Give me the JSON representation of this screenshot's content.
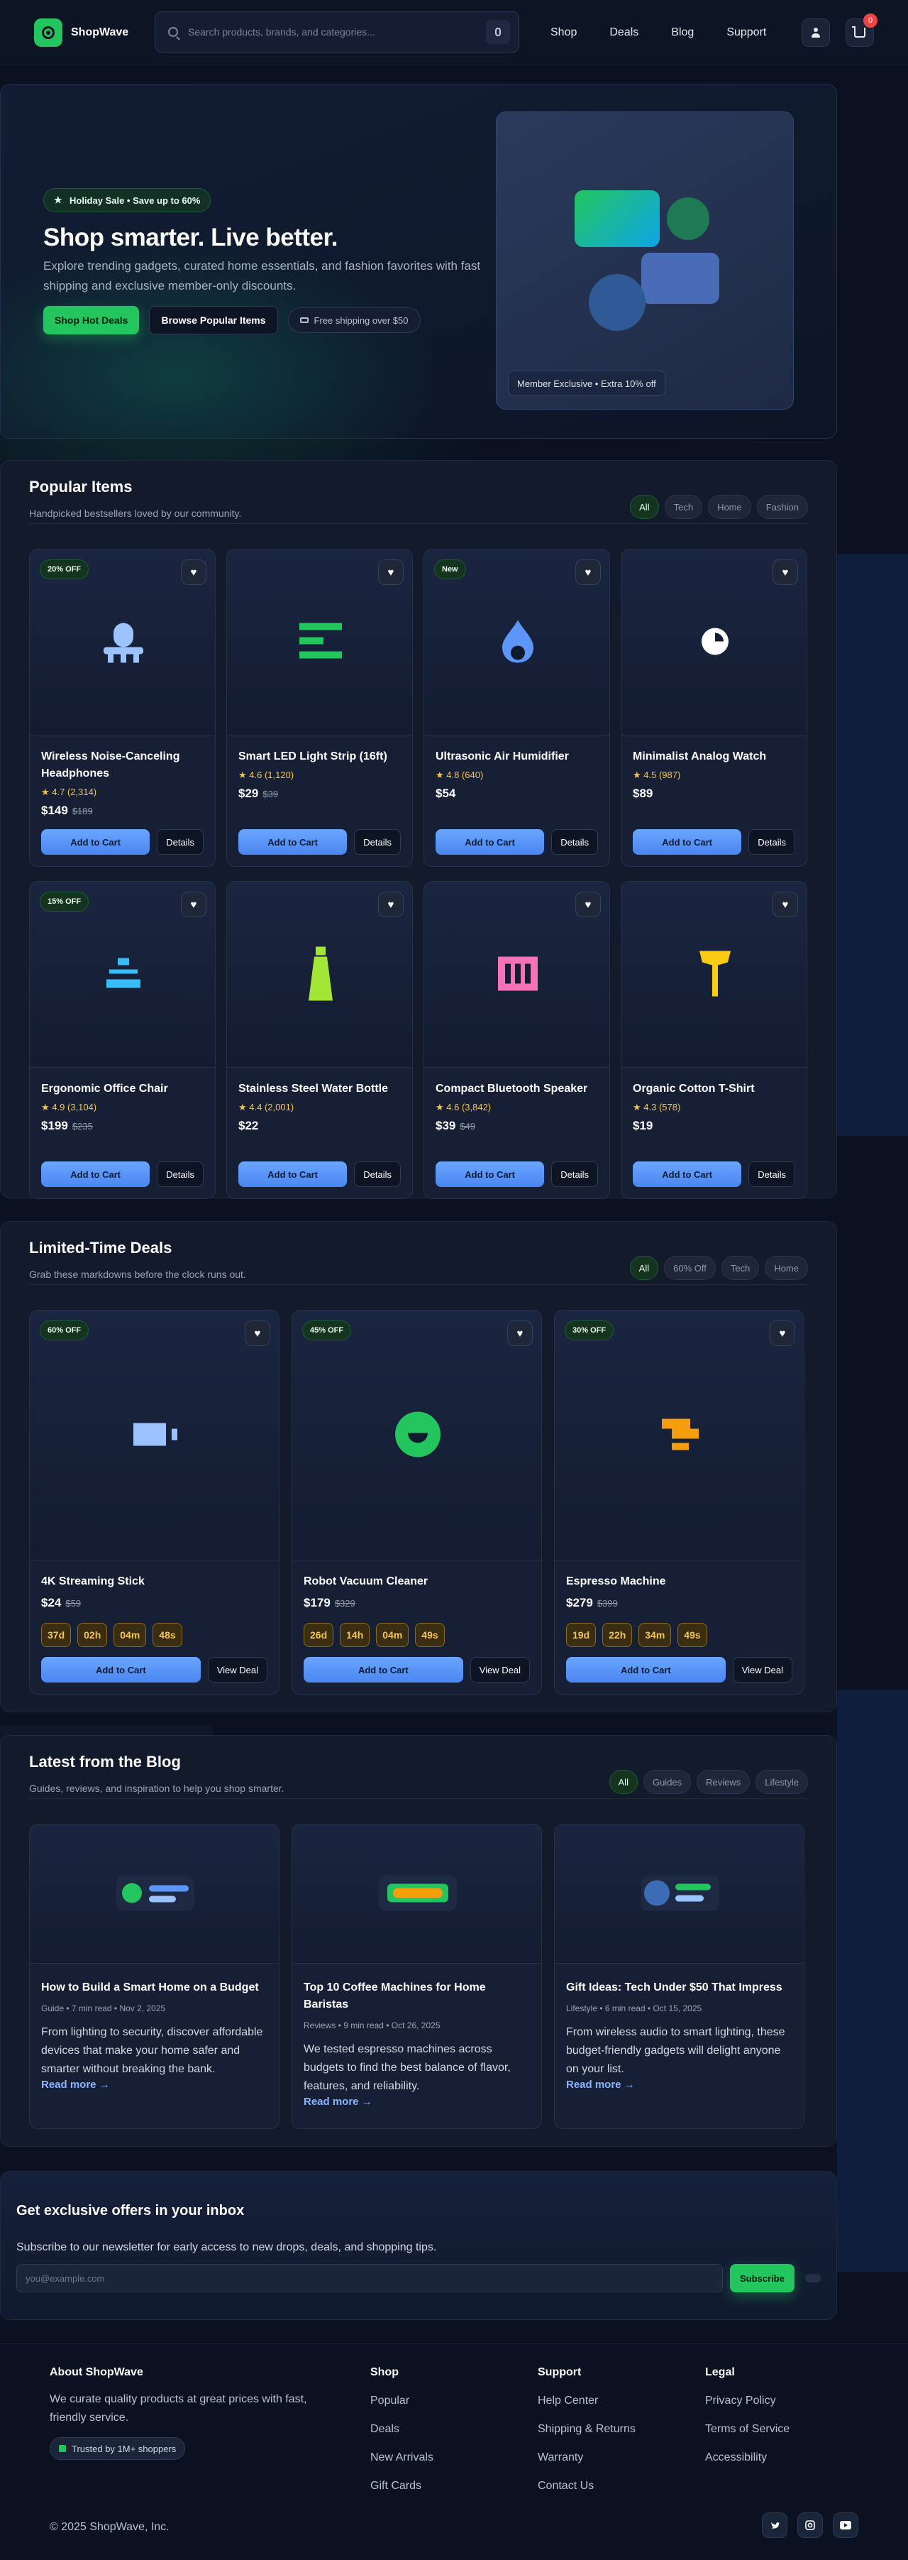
{
  "header": {
    "brand": "ShopWave",
    "search_placeholder": "Search products, brands, and categories...",
    "nav": [
      "Shop",
      "Deals",
      "Blog",
      "Support"
    ],
    "cart_count": "0"
  },
  "hero": {
    "badge": "Holiday Sale • Save up to 60%",
    "title": "Shop smarter. Live better.",
    "subtitle": "Explore trending gadgets, curated home essentials, and fashion favorites with fast shipping and exclusive member-only discounts.",
    "cta_primary": "Shop Hot Deals",
    "cta_secondary": "Browse Popular Items",
    "shipping_note": "Free shipping over $50",
    "member_badge": "Member Exclusive • Extra 10% off"
  },
  "popular": {
    "title": "Popular Items",
    "subtitle": "Handpicked bestsellers loved by our community.",
    "chips": [
      "All",
      "Tech",
      "Home",
      "Fashion"
    ],
    "add_label": "Add to Cart",
    "details_label": "Details",
    "items": [
      {
        "name": "Wireless Noise-Canceling Headphones",
        "rating": "★ 4.7 (2,314)",
        "price": "$149",
        "old_price": "$189",
        "badge": "20% OFF",
        "icon": "headphones-icon"
      },
      {
        "name": "Smart LED Light Strip (16ft)",
        "rating": "★ 4.6 (1,120)",
        "price": "$29",
        "old_price": "$39",
        "badge": "",
        "icon": "light-strip-icon"
      },
      {
        "name": "Ultrasonic Air Humidifier",
        "rating": "★ 4.8 (640)",
        "price": "$54",
        "old_price": "",
        "badge": "New",
        "icon": "droplet-icon"
      },
      {
        "name": "Minimalist Analog Watch",
        "rating": "★ 4.5 (987)",
        "price": "$89",
        "old_price": "",
        "badge": "",
        "icon": "clock-icon"
      },
      {
        "name": "Ergonomic Office Chair",
        "rating": "★ 4.9 (3,104)",
        "price": "$199",
        "old_price": "$235",
        "badge": "15% OFF",
        "icon": "chair-icon"
      },
      {
        "name": "Stainless Steel Water Bottle",
        "rating": "★ 4.4 (2,001)",
        "price": "$22",
        "old_price": "",
        "badge": "",
        "icon": "bottle-icon"
      },
      {
        "name": "Compact Bluetooth Speaker",
        "rating": "★ 4.6 (3,842)",
        "price": "$39",
        "old_price": "$49",
        "badge": "",
        "icon": "speaker-icon"
      },
      {
        "name": "Organic Cotton T-Shirt",
        "rating": "★ 4.3 (578)",
        "price": "$19",
        "old_price": "",
        "badge": "",
        "icon": "tshirt-icon"
      }
    ]
  },
  "deals": {
    "title": "Limited-Time Deals",
    "subtitle": "Grab these markdowns before the clock runs out.",
    "chips": [
      "All",
      "60% Off",
      "Tech",
      "Home"
    ],
    "add_label": "Add to Cart",
    "view_label": "View Deal",
    "items": [
      {
        "name": "4K Streaming Stick",
        "price": "$24",
        "old_price": "$59",
        "badge": "60% OFF",
        "timer": [
          "37d",
          "02h",
          "04m",
          "48s"
        ],
        "icon": "streaming-stick-icon"
      },
      {
        "name": "Robot Vacuum Cleaner",
        "price": "$179",
        "old_price": "$329",
        "badge": "45% OFF",
        "timer": [
          "26d",
          "14h",
          "04m",
          "49s"
        ],
        "icon": "robot-vacuum-icon"
      },
      {
        "name": "Espresso Machine",
        "price": "$279",
        "old_price": "$399",
        "badge": "30% OFF",
        "timer": [
          "19d",
          "22h",
          "34m",
          "49s"
        ],
        "icon": "espresso-icon"
      }
    ]
  },
  "blog": {
    "title": "Latest from the Blog",
    "subtitle": "Guides, reviews, and inspiration to help you shop smarter.",
    "chips": [
      "All",
      "Guides",
      "Reviews",
      "Lifestyle"
    ],
    "read_more": "Read more →",
    "posts": [
      {
        "title": "How to Build a Smart Home on a Budget",
        "meta": "Guide • 7 min read • Nov 2, 2025",
        "excerpt": "From lighting to security, discover affordable devices that make your home safer and smarter without breaking the bank."
      },
      {
        "title": "Top 10 Coffee Machines for Home Baristas",
        "meta": "Reviews • 9 min read • Oct 26, 2025",
        "excerpt": "We tested espresso machines across budgets to find the best balance of flavor, features, and reliability."
      },
      {
        "title": "Gift Ideas: Tech Under $50 That Impress",
        "meta": "Lifestyle • 6 min read • Oct 15, 2025",
        "excerpt": "From wireless audio to smart lighting, these budget-friendly gadgets will delight anyone on your list."
      }
    ]
  },
  "newsletter": {
    "title": "Get exclusive offers in your inbox",
    "text": "Subscribe to our newsletter for early access to new drops, deals, and shopping tips.",
    "placeholder": "you@example.com",
    "button": "Subscribe"
  },
  "footer": {
    "about_title": "About ShopWave",
    "about_text": "We curate quality products at great prices with fast, friendly service.",
    "trust": "Trusted by 1M+ shoppers",
    "shop_title": "Shop",
    "shop_links": [
      "Popular",
      "Deals",
      "New Arrivals",
      "Gift Cards"
    ],
    "support_title": "Support",
    "support_links": [
      "Help Center",
      "Shipping & Returns",
      "Warranty",
      "Contact Us"
    ],
    "legal_title": "Legal",
    "legal_links": [
      "Privacy Policy",
      "Terms of Service",
      "Accessibility"
    ],
    "copyright": "© 2025 ShopWave, Inc.",
    "socials": [
      "twitter-icon",
      "instagram-icon",
      "youtube-icon"
    ]
  },
  "colors": {
    "accent": "#22c55e",
    "button_blue": "#5b96f8",
    "background": "#0b1120",
    "timer_gold": "#f5c64b"
  }
}
